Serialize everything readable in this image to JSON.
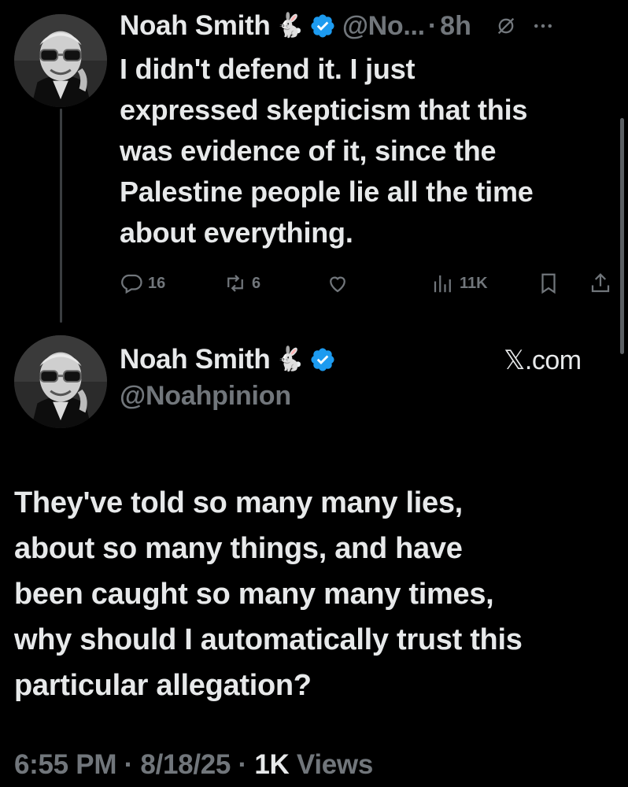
{
  "tweet1": {
    "author_name": "Noah Smith",
    "author_emoji": "🐇",
    "handle_truncated": "@No...",
    "separator": "·",
    "time": "8h",
    "text_lines": [
      "I didn't defend it. I just",
      "expressed skepticism that this",
      "was evidence of it, since the",
      "Palestine people lie all the time",
      "about everything."
    ],
    "actions": {
      "replies": "16",
      "reposts": "6",
      "views": "11K"
    }
  },
  "tweet2": {
    "author_name": "Noah Smith",
    "author_emoji": "🐇",
    "handle": "@Noahpinion",
    "source": "𝕏.com",
    "text_lines": [
      "They've told so many many lies,",
      "about so many things, and have",
      "been caught so many many times,",
      "why should I automatically trust this",
      "particular allegation?"
    ],
    "meta": {
      "time": "6:55 PM",
      "dot": " · ",
      "date": "8/18/25",
      "views_count": "1K",
      "views_label": "Views"
    }
  },
  "colors": {
    "background": "#000000",
    "text": "#e7e9ea",
    "muted": "#71767b",
    "verified": "#1d9bf0"
  },
  "icons": [
    "verified-badge-icon",
    "grok-icon",
    "more-icon",
    "reply-icon",
    "repost-icon",
    "like-icon",
    "views-icon",
    "bookmark-icon",
    "share-icon"
  ]
}
